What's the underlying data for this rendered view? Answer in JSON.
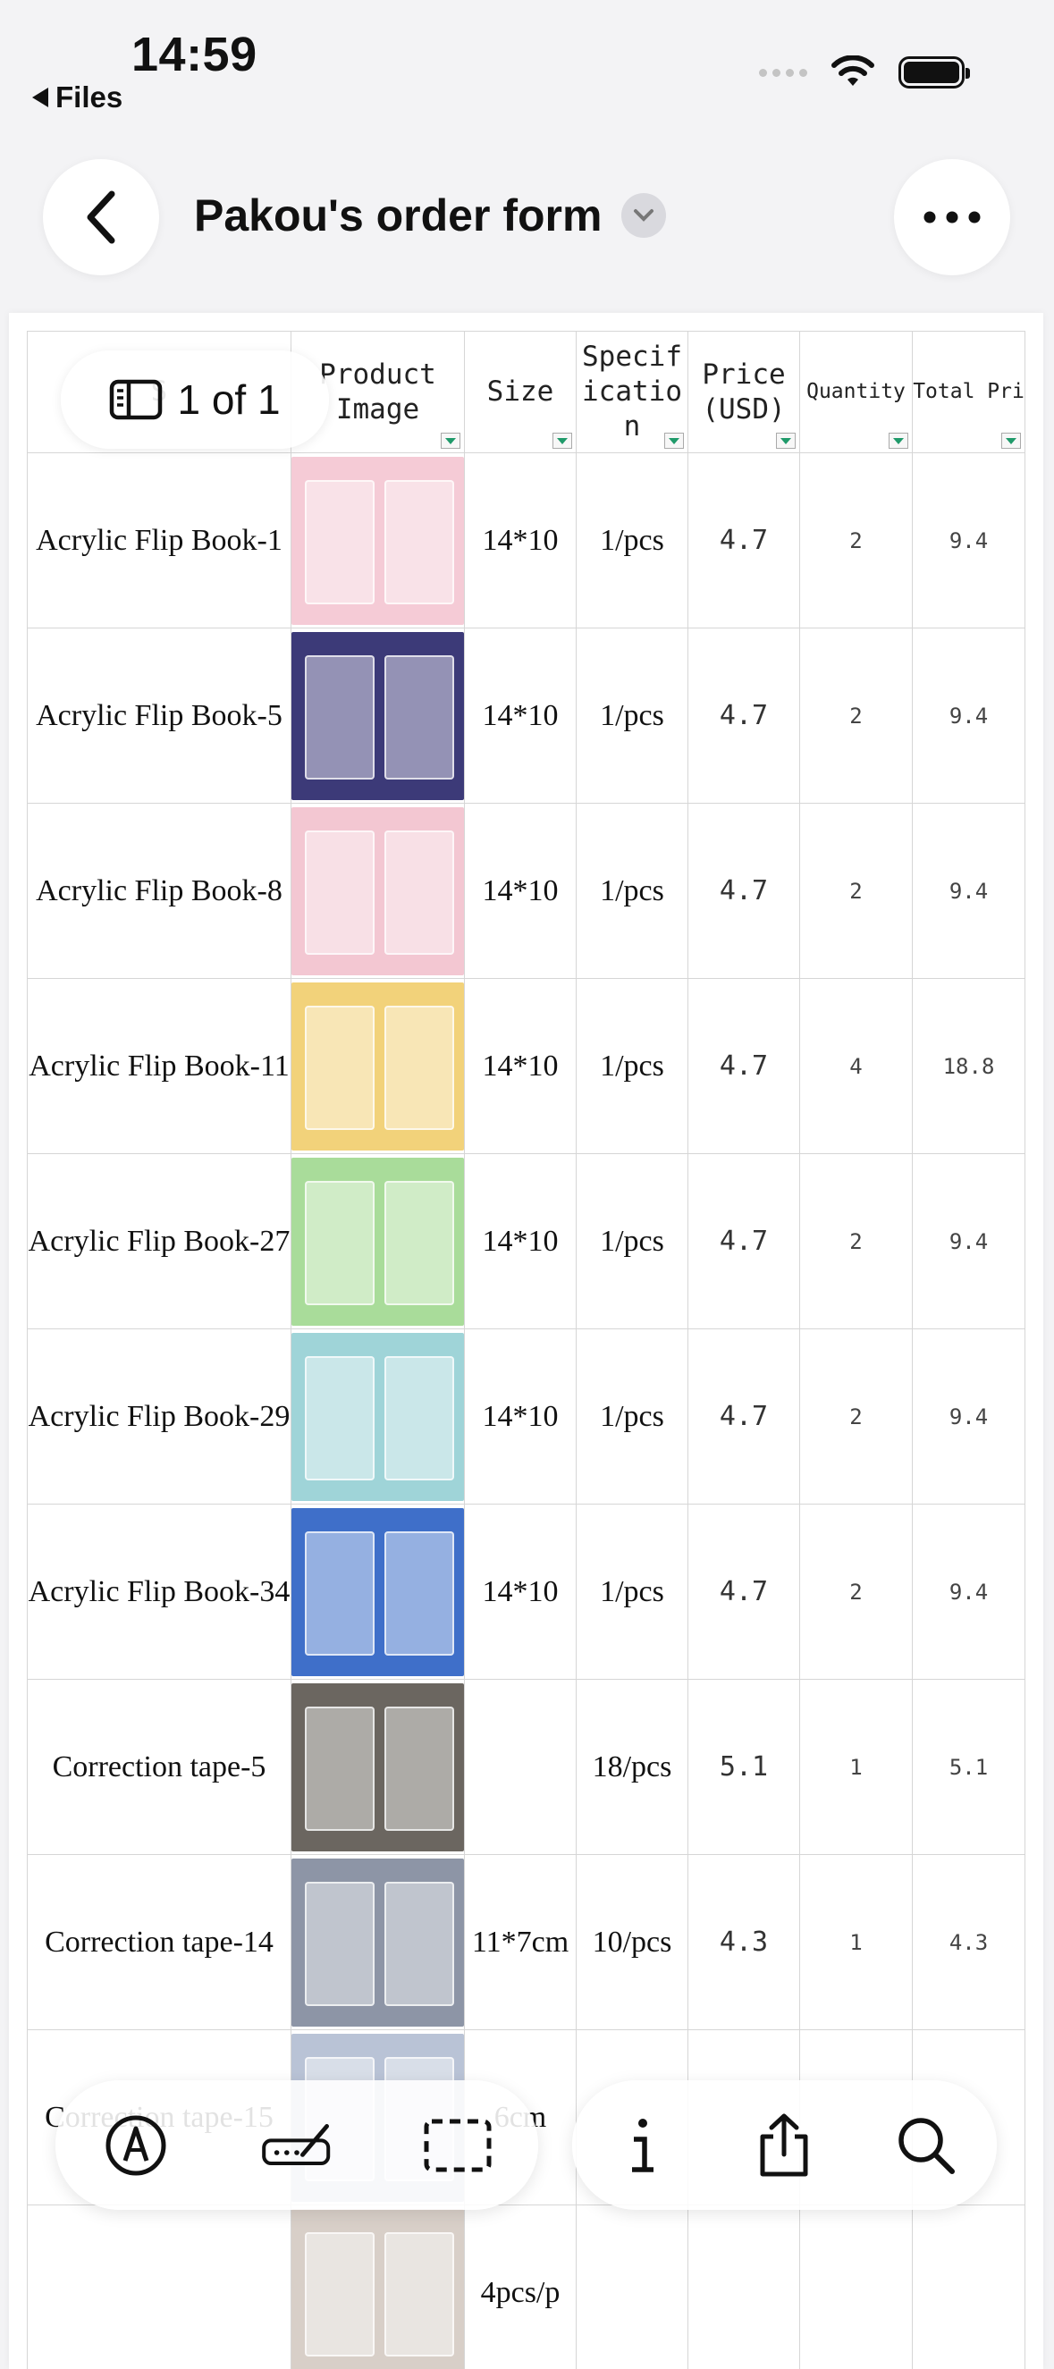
{
  "status_bar": {
    "time": "14:59",
    "back_app": "Files"
  },
  "header": {
    "title": "Pakou's order form"
  },
  "page_indicator": "1 of 1",
  "table": {
    "columns": [
      {
        "label": "S",
        "small": false
      },
      {
        "label": "Product\nImage",
        "small": false
      },
      {
        "label": "Size",
        "small": false
      },
      {
        "label": "Specif\nicatio\nn",
        "small": false
      },
      {
        "label": "Price\n(USD)",
        "small": false
      },
      {
        "label": "Quantity",
        "small": true
      },
      {
        "label": "Total Pri",
        "small": true
      }
    ],
    "rows": [
      {
        "name": "Acrylic Flip Book-1",
        "size": "14*10",
        "spec": "1/pcs",
        "price": "4.7",
        "qty": "2",
        "total": "9.4",
        "img": "#f5cbd6"
      },
      {
        "name": "Acrylic Flip Book-5",
        "size": "14*10",
        "spec": "1/pcs",
        "price": "4.7",
        "qty": "2",
        "total": "9.4",
        "img": "#3c3a78"
      },
      {
        "name": "Acrylic Flip Book-8",
        "size": "14*10",
        "spec": "1/pcs",
        "price": "4.7",
        "qty": "2",
        "total": "9.4",
        "img": "#f3c7d2"
      },
      {
        "name": "Acrylic Flip Book-11",
        "size": "14*10",
        "spec": "1/pcs",
        "price": "4.7",
        "qty": "4",
        "total": "18.8",
        "img": "#f2d27a"
      },
      {
        "name": "Acrylic Flip Book-27",
        "size": "14*10",
        "spec": "1/pcs",
        "price": "4.7",
        "qty": "2",
        "total": "9.4",
        "img": "#a9dc9a"
      },
      {
        "name": "Acrylic Flip Book-29",
        "size": "14*10",
        "spec": "1/pcs",
        "price": "4.7",
        "qty": "2",
        "total": "9.4",
        "img": "#9fd4d8"
      },
      {
        "name": "Acrylic Flip Book-34",
        "size": "14*10",
        "spec": "1/pcs",
        "price": "4.7",
        "qty": "2",
        "total": "9.4",
        "img": "#3f6fc9"
      },
      {
        "name": "Correction tape-5",
        "size": "",
        "spec": "18/pcs",
        "price": "5.1",
        "qty": "1",
        "total": "5.1",
        "img": "#6b6660"
      },
      {
        "name": "Correction tape-14",
        "size": "11*7cm",
        "spec": "10/pcs",
        "price": "4.3",
        "qty": "1",
        "total": "4.3",
        "img": "#8d95a6"
      },
      {
        "name": "Correction tape-15",
        "size": "6cm",
        "spec": "",
        "price": "",
        "qty": "",
        "total": "",
        "img": "#b9c3d6"
      },
      {
        "name": "",
        "size": "4pcs/p",
        "spec": "",
        "price": "",
        "qty": "",
        "total": "",
        "img": "#d8cfc8"
      }
    ]
  },
  "toolbar": {
    "left": [
      "markup-icon",
      "signature-icon",
      "select-icon"
    ],
    "right": [
      "info-icon",
      "share-icon",
      "search-icon"
    ]
  }
}
